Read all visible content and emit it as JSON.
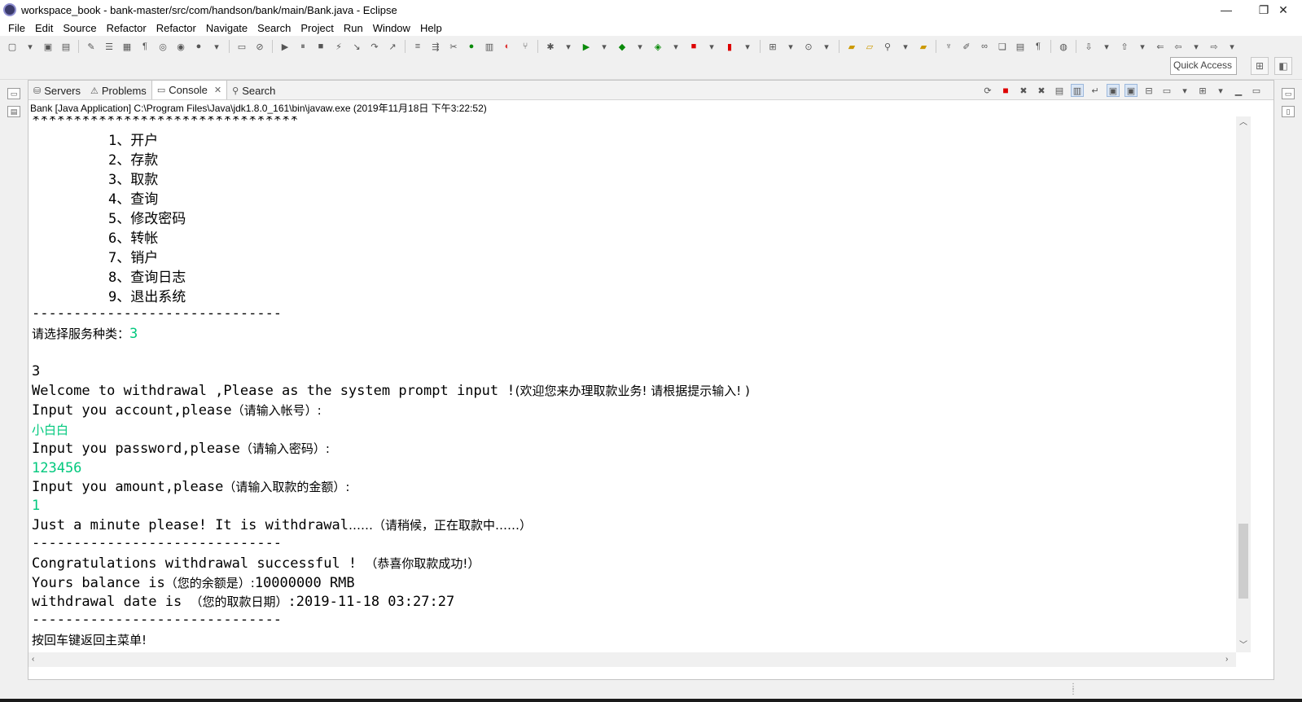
{
  "window": {
    "title": "workspace_book - bank-master/src/com/handson/bank/main/Bank.java - Eclipse",
    "minimize": "—",
    "restore": "❐",
    "close": "✕"
  },
  "menu": [
    "File",
    "Edit",
    "Source",
    "Refactor",
    "Refactor",
    "Navigate",
    "Search",
    "Project",
    "Run",
    "Window",
    "Help"
  ],
  "quick_access": {
    "placeholder": "Quick Access"
  },
  "view_tabs": [
    {
      "label": "Servers",
      "icon": "servers-icon"
    },
    {
      "label": "Problems",
      "icon": "problems-icon"
    },
    {
      "label": "Console",
      "icon": "console-icon",
      "close": "✕",
      "active": true
    },
    {
      "label": "Search",
      "icon": "search-icon"
    }
  ],
  "process_line": "Bank [Java Application] C:\\Program Files\\Java\\jdk1.8.0_161\\bin\\javaw.exe (2019年11月18日 下午3:22:52)",
  "console": {
    "stars": "********************************",
    "menu_items": [
      "1、开户",
      "2、存款",
      "3、取款",
      "4、查询",
      "5、修改密码",
      "6、转帐",
      "7、销户",
      "8、查询日志",
      "9、退出系统"
    ],
    "dashes": "------------------------------",
    "prompt_select": "请选择服务种类：",
    "input_select": "3",
    "echo_select": "3",
    "welcome_en": "Welcome to withdrawal ,Please as the system prompt input !",
    "welcome_cn": "(欢迎您来办理取款业务! 请根据提示输入! )",
    "account_en": "Input you account,please",
    "account_cn": "（请输入帐号）:",
    "account_value": "小白白",
    "password_en": "Input you password,please",
    "password_cn": "（请输入密码）:",
    "password_value": "123456",
    "amount_en": "Input you amount,please",
    "amount_cn": "（请输入取款的金额）:",
    "amount_value": "1",
    "wait_en": "Just a minute please! It is withdrawal",
    "wait_cn": "……（请稍候，正在取款中……）",
    "dashes2": "------------------------------",
    "success_en": "Congratulations withdrawal successful ! ",
    "success_cn": "（恭喜你取款成功!）",
    "balance_en": "Yours balance is",
    "balance_cn": "（您的余额是）:",
    "balance_value": "10000000 RMB",
    "date_en": "withdrawal date is ",
    "date_cn": "（您的取款日期）",
    "date_value": ":2019-11-18 03:27:27",
    "dashes3": "------------------------------",
    "return_msg": "按回车键返回主菜单!"
  },
  "colors": {
    "input_text": "#00c87d"
  }
}
